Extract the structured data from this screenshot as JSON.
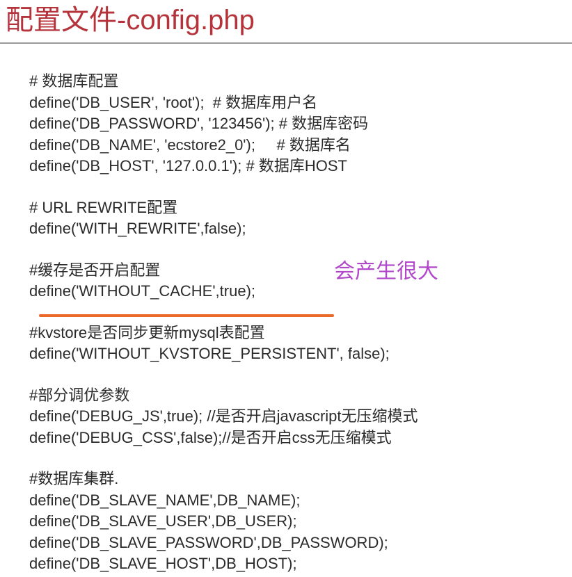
{
  "title": "配置文件-config.php",
  "annotation": "会产生很大",
  "colors": {
    "title": "#b5343c",
    "annotation": "#b148c9",
    "underline": "#ea6a2a",
    "code_text": "#2b2b2b"
  },
  "code_groups": [
    {
      "lines": [
        "# 数据库配置",
        "define('DB_USER', 'root');  # 数据库用户名",
        "define('DB_PASSWORD', '123456'); # 数据库密码",
        "define('DB_NAME', 'ecstore2_0');     # 数据库名",
        "define('DB_HOST', '127.0.0.1'); # 数据库HOST"
      ]
    },
    {
      "lines": [
        "# URL REWRITE配置",
        "define('WITH_REWRITE',false);"
      ]
    },
    {
      "lines": [
        "#缓存是否开启配置",
        "define('WITHOUT_CACHE',true);"
      ]
    },
    {
      "lines": [
        "#kvstore是否同步更新mysql表配置",
        "define('WITHOUT_KVSTORE_PERSISTENT', false);"
      ]
    },
    {
      "lines": [
        "#部分调优参数",
        "define('DEBUG_JS',true); //是否开启javascript无压缩模式",
        "define('DEBUG_CSS',false);//是否开启css无压缩模式"
      ]
    },
    {
      "lines": [
        "#数据库集群.",
        "define('DB_SLAVE_NAME',DB_NAME);",
        "define('DB_SLAVE_USER',DB_USER);",
        "define('DB_SLAVE_PASSWORD',DB_PASSWORD);",
        "define('DB_SLAVE_HOST',DB_HOST);"
      ]
    }
  ]
}
